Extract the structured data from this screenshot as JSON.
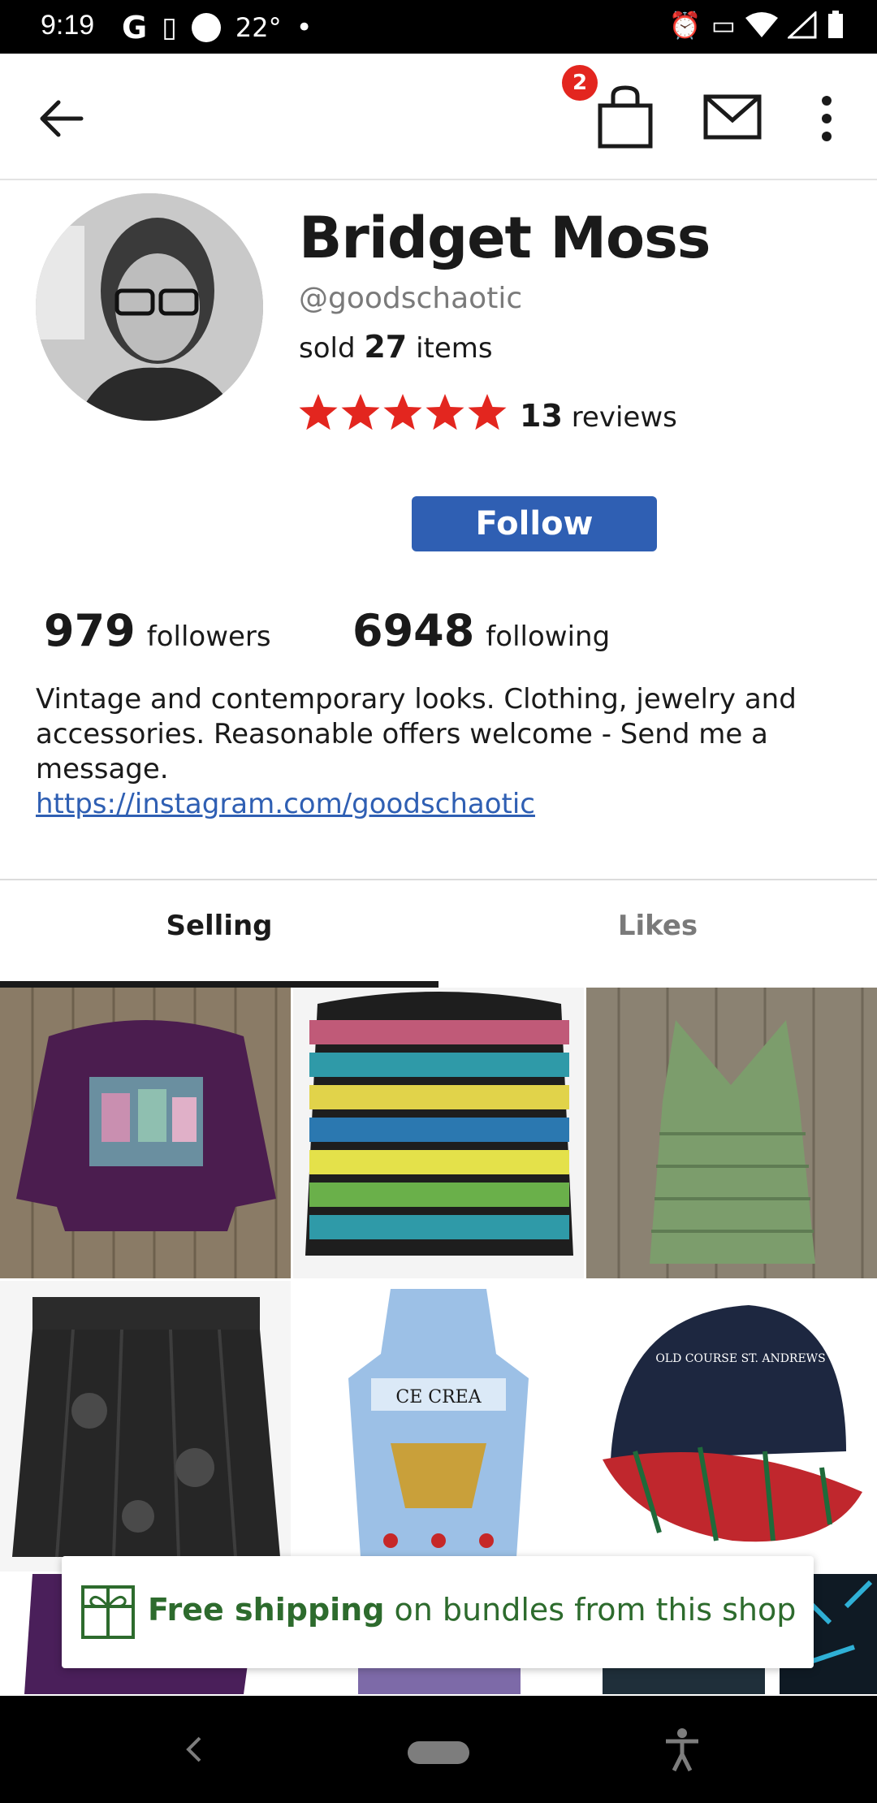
{
  "status_bar": {
    "time": "9:19",
    "temperature": "22°"
  },
  "header": {
    "cart_badge_count": "2"
  },
  "profile": {
    "name": "Bridget Moss",
    "handle": "@goodschaotic",
    "sold_prefix": "sold",
    "sold_count": "27",
    "sold_suffix": "items",
    "rating_stars": 5,
    "reviews_count": "13",
    "reviews_label": "reviews",
    "follow_label": "Follow",
    "followers_count": "979",
    "followers_label": "followers",
    "following_count": "6948",
    "following_label": "following",
    "bio": "Vintage and contemporary looks. Clothing, jewelry and accessories.  Reasonable offers welcome - Send me a message.",
    "bio_link": "https://instagram.com/goodschaotic"
  },
  "tabs": [
    {
      "label": "Selling",
      "active": true
    },
    {
      "label": "Likes",
      "active": false
    }
  ],
  "grid_items": [
    {
      "name": "purple-sweatshirt-item"
    },
    {
      "name": "woven-backpack-item"
    },
    {
      "name": "green-dress-item"
    },
    {
      "name": "black-skirt-item"
    },
    {
      "name": "ice-cream-apron-item",
      "print": "CE CREA"
    },
    {
      "name": "plaid-cap-item",
      "print": "OLD COURSE ST. ANDREWS"
    }
  ],
  "banner": {
    "bold": "Free shipping",
    "rest": " on bundles from this shop"
  },
  "colors": {
    "accent_blue": "#2f5fb3",
    "badge_red": "#e3261f",
    "star_red": "#e3261f",
    "ship_green": "#2d6b2d"
  }
}
